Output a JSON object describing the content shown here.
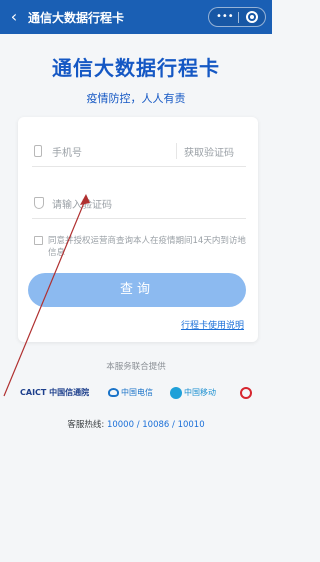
{
  "header": {
    "back_glyph": "‹",
    "title": "通信大数据行程卡",
    "more_glyph": "•••"
  },
  "brand": {
    "title": "通信大数据行程卡",
    "subtitle": "疫情防控，人人有责"
  },
  "form": {
    "phone_placeholder": "手机号",
    "get_code_label": "获取验证码",
    "code_placeholder": "请输入验证码",
    "agree_text": "同意并授权运营商查询本人在疫情期间14天内到访地信息",
    "query_label": "查询",
    "guide_link": "行程卡使用说明"
  },
  "partners": {
    "label": "本服务联合提供",
    "items": [
      {
        "name": "CAICT 中国信通院",
        "icon": "caict-logo"
      },
      {
        "name": "中国电信",
        "icon": "china-telecom-logo"
      },
      {
        "name": "中国移动",
        "icon": "china-mobile-logo"
      },
      {
        "name": "China unicom",
        "icon": "china-unicom-logo"
      }
    ]
  },
  "footer": {
    "hotline_label": "客服热线: ",
    "hotline_numbers": "10000 / 10086 / 10010"
  },
  "colors": {
    "header": "#1a5fb4",
    "brand": "#1558c4",
    "button": "#8cbaf0",
    "link": "#1a6fd8",
    "annotation_arrow": "#b03030"
  }
}
